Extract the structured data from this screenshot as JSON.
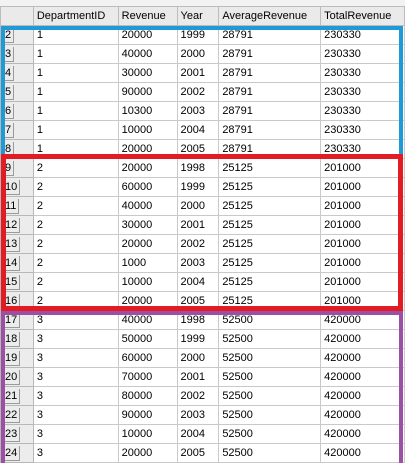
{
  "colors": {
    "group_1_outline": "#1f9ad6",
    "group_2_outline": "#e31b23",
    "group_3_outline": "#9b4fa5",
    "header_background": "#eaeaea",
    "row_number_background": "#ececec"
  },
  "grid": {
    "columns": [
      "",
      "DepartmentID",
      "Revenue",
      "Year",
      "AverageRevenue",
      "TotalRevenue"
    ],
    "rows": [
      {
        "num": "2",
        "cells": [
          "1",
          "20000",
          "1999",
          "28791",
          "230330"
        ]
      },
      {
        "num": "3",
        "cells": [
          "1",
          "40000",
          "2000",
          "28791",
          "230330"
        ]
      },
      {
        "num": "4",
        "cells": [
          "1",
          "30000",
          "2001",
          "28791",
          "230330"
        ]
      },
      {
        "num": "5",
        "cells": [
          "1",
          "90000",
          "2002",
          "28791",
          "230330"
        ]
      },
      {
        "num": "6",
        "cells": [
          "1",
          "10300",
          "2003",
          "28791",
          "230330"
        ]
      },
      {
        "num": "7",
        "cells": [
          "1",
          "10000",
          "2004",
          "28791",
          "230330"
        ]
      },
      {
        "num": "8",
        "cells": [
          "1",
          "20000",
          "2005",
          "28791",
          "230330"
        ]
      },
      {
        "num": "9",
        "cells": [
          "2",
          "20000",
          "1998",
          "25125",
          "201000"
        ]
      },
      {
        "num": "10",
        "cells": [
          "2",
          "60000",
          "1999",
          "25125",
          "201000"
        ]
      },
      {
        "num": "11",
        "cells": [
          "2",
          "40000",
          "2000",
          "25125",
          "201000"
        ]
      },
      {
        "num": "12",
        "cells": [
          "2",
          "30000",
          "2001",
          "25125",
          "201000"
        ]
      },
      {
        "num": "13",
        "cells": [
          "2",
          "20000",
          "2002",
          "25125",
          "201000"
        ]
      },
      {
        "num": "14",
        "cells": [
          "2",
          "1000",
          "2003",
          "25125",
          "201000"
        ]
      },
      {
        "num": "15",
        "cells": [
          "2",
          "10000",
          "2004",
          "25125",
          "201000"
        ]
      },
      {
        "num": "16",
        "cells": [
          "2",
          "20000",
          "2005",
          "25125",
          "201000"
        ]
      },
      {
        "num": "17",
        "cells": [
          "3",
          "40000",
          "1998",
          "52500",
          "420000"
        ]
      },
      {
        "num": "18",
        "cells": [
          "3",
          "50000",
          "1999",
          "52500",
          "420000"
        ]
      },
      {
        "num": "19",
        "cells": [
          "3",
          "60000",
          "2000",
          "52500",
          "420000"
        ]
      },
      {
        "num": "20",
        "cells": [
          "3",
          "70000",
          "2001",
          "52500",
          "420000"
        ]
      },
      {
        "num": "21",
        "cells": [
          "3",
          "80000",
          "2002",
          "52500",
          "420000"
        ]
      },
      {
        "num": "22",
        "cells": [
          "3",
          "90000",
          "2003",
          "52500",
          "420000"
        ]
      },
      {
        "num": "23",
        "cells": [
          "3",
          "10000",
          "2004",
          "52500",
          "420000"
        ]
      },
      {
        "num": "24",
        "cells": [
          "3",
          "20000",
          "2005",
          "52500",
          "420000"
        ]
      }
    ]
  }
}
